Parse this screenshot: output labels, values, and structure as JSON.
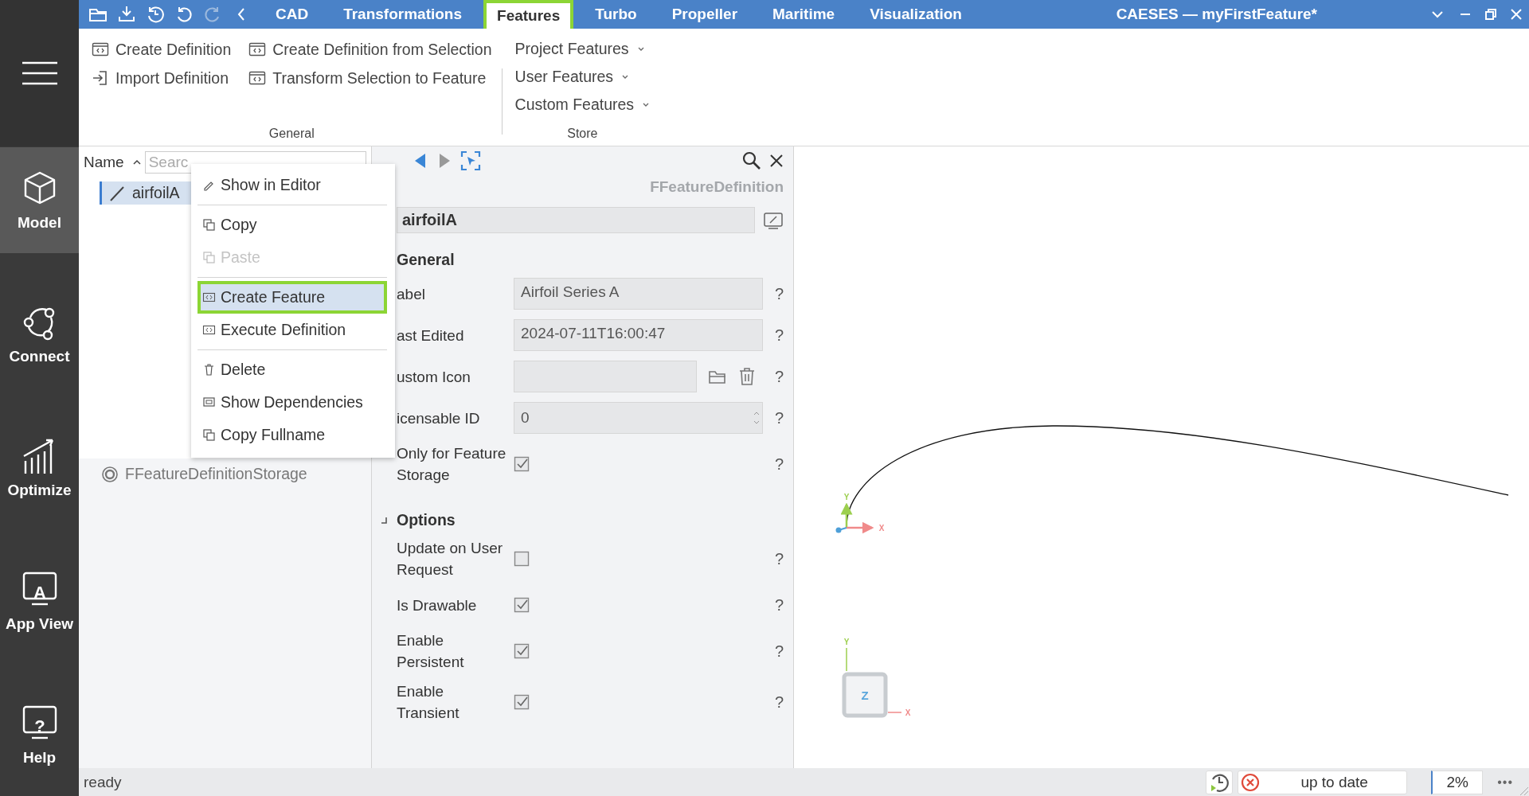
{
  "window": {
    "title": "CAESES — myFirstFeature*"
  },
  "quick_toolbar": [
    {
      "disabled": false
    },
    {
      "disabled": false
    },
    {
      "disabled": false
    },
    {
      "disabled": false
    },
    {
      "disabled": true
    },
    {
      "disabled": false
    }
  ],
  "tabs": [
    {
      "label": "CAD",
      "selected": false,
      "highlighted": false
    },
    {
      "label": "Transformations",
      "selected": false,
      "highlighted": false
    },
    {
      "label": "Features",
      "selected": true,
      "highlighted": true
    },
    {
      "label": "Turbo",
      "selected": false,
      "highlighted": false
    },
    {
      "label": "Propeller",
      "selected": false,
      "highlighted": false
    },
    {
      "label": "Maritime",
      "selected": false,
      "highlighted": false
    },
    {
      "label": "Visualization",
      "selected": false,
      "highlighted": false
    }
  ],
  "sidebar": {
    "items": [
      {
        "label": "Model",
        "selected": true
      },
      {
        "label": "Connect",
        "selected": false
      },
      {
        "label": "Optimize",
        "selected": false
      },
      {
        "label": "App View",
        "selected": false,
        "glyph": "A"
      },
      {
        "label": "Help",
        "selected": false,
        "glyph": "?"
      }
    ]
  },
  "ribbon": {
    "groups": [
      {
        "label": "General",
        "kind": "grid",
        "buttons": [
          {
            "label": "Create Definition"
          },
          {
            "label": "Import Definition"
          },
          {
            "label": "Create Definition from Selection"
          },
          {
            "label": "Transform Selection to Feature"
          }
        ]
      },
      {
        "label": "Store",
        "kind": "dropdowns",
        "buttons": [
          {
            "label": "Project Features"
          },
          {
            "label": "User Features"
          },
          {
            "label": "Custom Features"
          }
        ]
      }
    ]
  },
  "tree": {
    "column": "Name",
    "search": {
      "placeholder": "Searc"
    },
    "items": [
      {
        "label": "airfoilA",
        "selected": true
      }
    ]
  },
  "storage": {
    "items": [
      {
        "label": "FFeatureDefinitionStorage"
      }
    ]
  },
  "context_menu": {
    "items": [
      {
        "kind": "item",
        "label": "Show in Editor",
        "disabled": false,
        "selected": false,
        "highlighted": false
      },
      {
        "kind": "separator"
      },
      {
        "kind": "item",
        "label": "Copy",
        "disabled": false,
        "selected": false,
        "highlighted": false
      },
      {
        "kind": "item",
        "label": "Paste",
        "disabled": true,
        "selected": false,
        "highlighted": false
      },
      {
        "kind": "separator"
      },
      {
        "kind": "item",
        "label": "Create Feature",
        "disabled": false,
        "selected": true,
        "highlighted": true
      },
      {
        "kind": "item",
        "label": "Execute Definition",
        "disabled": false,
        "selected": false,
        "highlighted": false
      },
      {
        "kind": "separator"
      },
      {
        "kind": "item",
        "label": "Delete",
        "disabled": false,
        "selected": false,
        "highlighted": false
      },
      {
        "kind": "item",
        "label": "Show Dependencies",
        "disabled": false,
        "selected": false,
        "highlighted": false
      },
      {
        "kind": "item",
        "label": "Copy Fullname",
        "disabled": false,
        "selected": false,
        "highlighted": false
      }
    ]
  },
  "properties": {
    "nav": [
      {
        "disabled": false
      },
      {
        "disabled": true
      }
    ],
    "type": "FFeatureDefinition",
    "name": "airfoilA",
    "sections": [
      {
        "title": "General",
        "rows": [
          {
            "kind": "text",
            "label": "abel",
            "value": "Airfoil Series A",
            "help": "?"
          },
          {
            "kind": "text",
            "label": "ast Edited",
            "value": "2024-07-11T16:00:47",
            "help": "?"
          },
          {
            "kind": "icon_picker",
            "label": "ustom Icon",
            "help": "?"
          },
          {
            "kind": "spin",
            "label": "icensable ID",
            "value": "0",
            "help": "?"
          },
          {
            "kind": "check",
            "label": "Only for Feature Storage",
            "checked": true,
            "help": "?"
          }
        ]
      },
      {
        "title": "Options",
        "expanded": true,
        "rows": [
          {
            "kind": "check",
            "label": "Update on User Request",
            "checked": false,
            "help": "?"
          },
          {
            "kind": "check",
            "label": "Is Drawable",
            "checked": true,
            "help": "?"
          },
          {
            "kind": "check",
            "label": "Enable Persistent",
            "checked": true,
            "help": "?"
          },
          {
            "kind": "check",
            "label": "Enable Transient",
            "checked": true,
            "help": "?"
          }
        ]
      }
    ]
  },
  "viewport": {
    "axes": {
      "x": "X",
      "y": "Y"
    },
    "view_cube": {
      "face": "Z",
      "x": "X",
      "y": "Y"
    }
  },
  "status_bar": {
    "message": "ready",
    "build_status": "up to date",
    "build_error": true,
    "progress": "2%",
    "more": "•••"
  }
}
